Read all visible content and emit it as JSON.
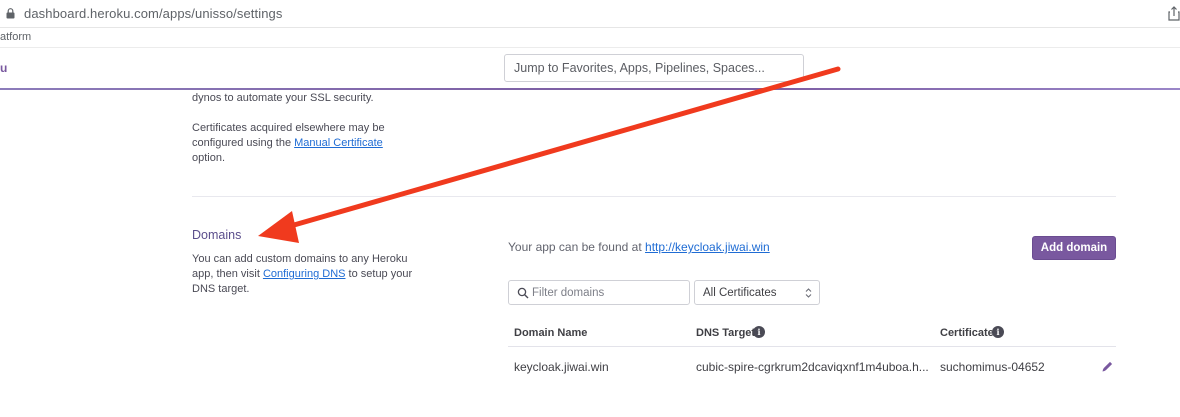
{
  "browser": {
    "url": "dashboard.heroku.com/apps/unisso/settings",
    "bookmark": "atform"
  },
  "header": {
    "brand_fragment": "u",
    "jump_placeholder": "Jump to Favorites, Apps, Pipelines, Spaces..."
  },
  "ssl": {
    "p1": "dynos to automate your SSL security.",
    "p2_before": "Certificates acquired elsewhere may be configured using the ",
    "p2_link": "Manual Certificate",
    "p2_after": " option."
  },
  "domains": {
    "title": "Domains",
    "desc_before": "You can add custom domains to any Heroku app, then visit ",
    "desc_link": "Configuring DNS",
    "desc_after": " to setup your DNS target.",
    "found_prefix": "Your app can be found at ",
    "found_link": "http://keycloak.jiwai.win",
    "add_button": "Add domain",
    "filter_placeholder": "Filter domains",
    "cert_filter": "All Certificates",
    "columns": {
      "domain_name": "Domain Name",
      "dns_target": "DNS Target",
      "certificate": "Certificate"
    },
    "rows": [
      {
        "domain_name": "keycloak.jiwai.win",
        "dns_target": "cubic-spire-cgrkrum2dcaviqxnf1m4uboa.h...",
        "certificate": "suchomimus-04652"
      }
    ]
  },
  "colors": {
    "heroku_purple": "#79589f",
    "link_blue": "#1f6cd4",
    "annotation_red": "#f03a1e"
  },
  "icons": [
    "lock-icon",
    "share-icon",
    "search-icon",
    "select-arrows-icon",
    "info-icon",
    "pencil-icon"
  ],
  "info_icon_glyph": "i"
}
